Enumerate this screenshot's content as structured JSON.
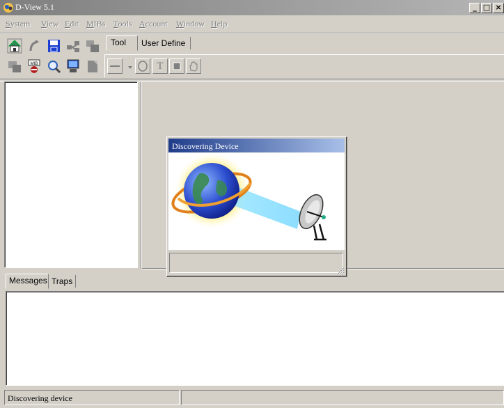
{
  "window": {
    "title": "D-View 5.1"
  },
  "menu": [
    {
      "label": "System",
      "u": "S",
      "rest": "ystem"
    },
    {
      "label": "View",
      "u": "V",
      "rest": "iew"
    },
    {
      "label": "Edit",
      "u": "E",
      "rest": "dit"
    },
    {
      "label": "MIBs",
      "u": "M",
      "rest": "IBs"
    },
    {
      "label": "Tools",
      "u": "T",
      "rest": "ools"
    },
    {
      "label": "Account",
      "u": "A",
      "rest": "ccount"
    },
    {
      "label": "Window",
      "u": "W",
      "rest": "indow"
    },
    {
      "label": "Help",
      "u": "H",
      "rest": "elp"
    }
  ],
  "toolbar": {
    "row1_icons": [
      "home-icon",
      "refresh-icon",
      "save-icon",
      "network-icon",
      "cascade-icon"
    ],
    "row2_icons": [
      "windows-icon",
      "mib-icon",
      "search-icon",
      "monitor-icon",
      "properties-icon"
    ],
    "mib_text": "MIB",
    "tabs": [
      "Tool",
      "User Define"
    ],
    "draw_tools": [
      "line-icon",
      "dropdown-arrow-icon",
      "ellipse-icon",
      "text-tool-icon",
      "rectangle-icon",
      "hand-icon"
    ],
    "text_tool_glyph": "T"
  },
  "dialog": {
    "title": "Discovering Device"
  },
  "messages": {
    "tabs": [
      "Messages",
      "Traps"
    ]
  },
  "status": {
    "text": "Discovering device",
    "secondary": ""
  },
  "colors": {
    "window_bg": "#d4d0c8",
    "dialog_title_start": "#1f3c8a",
    "dialog_title_end": "#a8c0e8",
    "titlebar": "#9a9a9a"
  }
}
